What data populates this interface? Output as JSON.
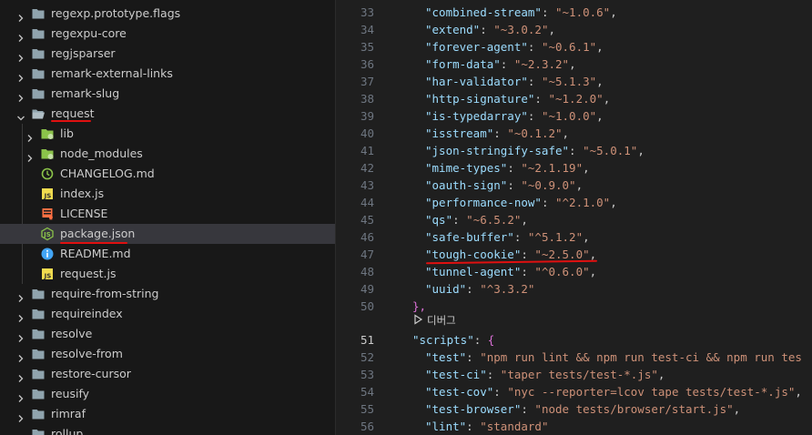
{
  "explorer": {
    "items": [
      {
        "name": "regexp.prototype.flags",
        "type": "folder",
        "state": "collapsed",
        "depth": 0
      },
      {
        "name": "regexpu-core",
        "type": "folder",
        "state": "collapsed",
        "depth": 0
      },
      {
        "name": "regjsparser",
        "type": "folder",
        "state": "collapsed",
        "depth": 0
      },
      {
        "name": "remark-external-links",
        "type": "folder",
        "state": "collapsed",
        "depth": 0
      },
      {
        "name": "remark-slug",
        "type": "folder",
        "state": "collapsed",
        "depth": 0
      },
      {
        "name": "request",
        "type": "folder",
        "state": "expanded",
        "depth": 0
      },
      {
        "name": "lib",
        "type": "folder-special",
        "state": "collapsed",
        "depth": 1
      },
      {
        "name": "node_modules",
        "type": "folder-special",
        "state": "collapsed",
        "depth": 1
      },
      {
        "name": "CHANGELOG.md",
        "type": "changelog",
        "depth": 1
      },
      {
        "name": "index.js",
        "type": "js",
        "depth": 1
      },
      {
        "name": "LICENSE",
        "type": "license",
        "depth": 1
      },
      {
        "name": "package.json",
        "type": "json",
        "depth": 1,
        "selected": true
      },
      {
        "name": "README.md",
        "type": "readme",
        "depth": 1
      },
      {
        "name": "request.js",
        "type": "js",
        "depth": 1
      },
      {
        "name": "require-from-string",
        "type": "folder",
        "state": "collapsed",
        "depth": 0
      },
      {
        "name": "requireindex",
        "type": "folder",
        "state": "collapsed",
        "depth": 0
      },
      {
        "name": "resolve",
        "type": "folder",
        "state": "collapsed",
        "depth": 0
      },
      {
        "name": "resolve-from",
        "type": "folder",
        "state": "collapsed",
        "depth": 0
      },
      {
        "name": "restore-cursor",
        "type": "folder",
        "state": "collapsed",
        "depth": 0
      },
      {
        "name": "reusify",
        "type": "folder",
        "state": "collapsed",
        "depth": 0
      },
      {
        "name": "rimraf",
        "type": "folder",
        "state": "collapsed",
        "depth": 0
      },
      {
        "name": "rollup",
        "type": "folder",
        "state": "collapsed",
        "depth": 0
      }
    ]
  },
  "editor": {
    "active_line": "51",
    "codelens_label": "디버그",
    "lines": [
      {
        "num": "33",
        "key": "\"combined-stream\"",
        "sep": ": ",
        "val": "\"~1.0.6\"",
        "end": ","
      },
      {
        "num": "34",
        "key": "\"extend\"",
        "sep": ": ",
        "val": "\"~3.0.2\"",
        "end": ","
      },
      {
        "num": "35",
        "key": "\"forever-agent\"",
        "sep": ": ",
        "val": "\"~0.6.1\"",
        "end": ","
      },
      {
        "num": "36",
        "key": "\"form-data\"",
        "sep": ": ",
        "val": "\"~2.3.2\"",
        "end": ","
      },
      {
        "num": "37",
        "key": "\"har-validator\"",
        "sep": ": ",
        "val": "\"~5.1.3\"",
        "end": ","
      },
      {
        "num": "38",
        "key": "\"http-signature\"",
        "sep": ": ",
        "val": "\"~1.2.0\"",
        "end": ","
      },
      {
        "num": "39",
        "key": "\"is-typedarray\"",
        "sep": ": ",
        "val": "\"~1.0.0\"",
        "end": ","
      },
      {
        "num": "40",
        "key": "\"isstream\"",
        "sep": ": ",
        "val": "\"~0.1.2\"",
        "end": ","
      },
      {
        "num": "41",
        "key": "\"json-stringify-safe\"",
        "sep": ": ",
        "val": "\"~5.0.1\"",
        "end": ","
      },
      {
        "num": "42",
        "key": "\"mime-types\"",
        "sep": ": ",
        "val": "\"~2.1.19\"",
        "end": ","
      },
      {
        "num": "43",
        "key": "\"oauth-sign\"",
        "sep": ": ",
        "val": "\"~0.9.0\"",
        "end": ","
      },
      {
        "num": "44",
        "key": "\"performance-now\"",
        "sep": ": ",
        "val": "\"^2.1.0\"",
        "end": ","
      },
      {
        "num": "45",
        "key": "\"qs\"",
        "sep": ": ",
        "val": "\"~6.5.2\"",
        "end": ","
      },
      {
        "num": "46",
        "key": "\"safe-buffer\"",
        "sep": ": ",
        "val": "\"^5.1.2\"",
        "end": ","
      },
      {
        "num": "47",
        "key": "\"tough-cookie\"",
        "sep": ": ",
        "val": "\"~2.5.0\"",
        "end": ","
      },
      {
        "num": "48",
        "key": "\"tunnel-agent\"",
        "sep": ": ",
        "val": "\"^0.6.0\"",
        "end": ","
      },
      {
        "num": "49",
        "key": "\"uuid\"",
        "sep": ": ",
        "val": "\"^3.3.2\"",
        "end": ""
      },
      {
        "num": "50",
        "close": "},"
      },
      {
        "num": "51",
        "key": "\"scripts\"",
        "sep": ": ",
        "open": "{",
        "level": 1
      },
      {
        "num": "52",
        "key": "\"test\"",
        "sep": ": ",
        "val": "\"npm run lint && npm run test-ci && npm run tes",
        "end": ""
      },
      {
        "num": "53",
        "key": "\"test-ci\"",
        "sep": ": ",
        "val": "\"taper tests/test-*.js\"",
        "end": ","
      },
      {
        "num": "54",
        "key": "\"test-cov\"",
        "sep": ": ",
        "val": "\"nyc --reporter=lcov tape tests/test-*.js\"",
        "end": ","
      },
      {
        "num": "55",
        "key": "\"test-browser\"",
        "sep": ": ",
        "val": "\"node tests/browser/start.js\"",
        "end": ","
      },
      {
        "num": "56",
        "key": "\"lint\"",
        "sep": ": ",
        "val": "\"standard\"",
        "end": ""
      }
    ]
  },
  "colors": {
    "annotation": "#e01010",
    "json_key": "#9cdcfe",
    "json_string": "#ce9178",
    "bracket": "#da70d6",
    "selected_row": "#37373d"
  }
}
